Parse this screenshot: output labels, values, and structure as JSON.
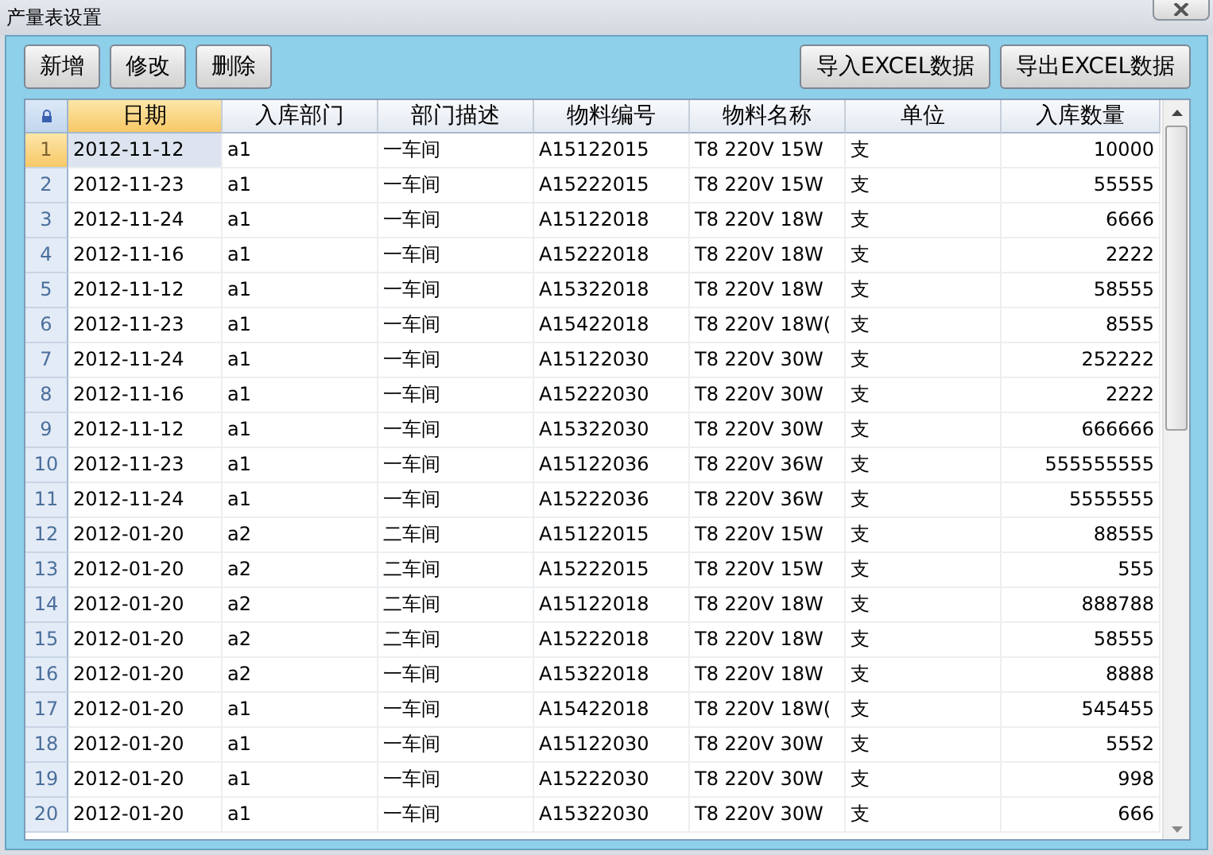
{
  "window": {
    "title": "产量表设置"
  },
  "toolbar": {
    "left_buttons": [
      "新增",
      "修改",
      "删除"
    ],
    "right_buttons": [
      "导入EXCEL数据",
      "导出EXCEL数据"
    ]
  },
  "table": {
    "columns": [
      {
        "label": "日期",
        "selected": true
      },
      {
        "label": "入库部门",
        "selected": false
      },
      {
        "label": "部门描述",
        "selected": false
      },
      {
        "label": "物料编号",
        "selected": false
      },
      {
        "label": "物料名称",
        "selected": false
      },
      {
        "label": "单位",
        "selected": false
      },
      {
        "label": "入库数量",
        "selected": false
      }
    ],
    "rows": [
      {
        "num": "1",
        "selected": true,
        "cells": [
          "2012-11-12",
          "a1",
          "一车间",
          "A15122015",
          "T8 220V 15W",
          "支",
          "10000"
        ]
      },
      {
        "num": "2",
        "selected": false,
        "cells": [
          "2012-11-23",
          "a1",
          "一车间",
          "A15222015",
          "T8 220V 15W",
          "支",
          "55555"
        ]
      },
      {
        "num": "3",
        "selected": false,
        "cells": [
          "2012-11-24",
          "a1",
          "一车间",
          "A15122018",
          "T8 220V 18W",
          "支",
          "6666"
        ]
      },
      {
        "num": "4",
        "selected": false,
        "cells": [
          "2012-11-16",
          "a1",
          "一车间",
          "A15222018",
          "T8 220V 18W",
          "支",
          "2222"
        ]
      },
      {
        "num": "5",
        "selected": false,
        "cells": [
          "2012-11-12",
          "a1",
          "一车间",
          "A15322018",
          "T8 220V 18W",
          "支",
          "58555"
        ]
      },
      {
        "num": "6",
        "selected": false,
        "cells": [
          "2012-11-23",
          "a1",
          "一车间",
          "A15422018",
          "T8 220V 18W(",
          "支",
          "8555"
        ]
      },
      {
        "num": "7",
        "selected": false,
        "cells": [
          "2012-11-24",
          "a1",
          "一车间",
          "A15122030",
          "T8 220V 30W",
          "支",
          "252222"
        ]
      },
      {
        "num": "8",
        "selected": false,
        "cells": [
          "2012-11-16",
          "a1",
          "一车间",
          "A15222030",
          "T8 220V 30W",
          "支",
          "2222"
        ]
      },
      {
        "num": "9",
        "selected": false,
        "cells": [
          "2012-11-12",
          "a1",
          "一车间",
          "A15322030",
          "T8 220V 30W",
          "支",
          "666666"
        ]
      },
      {
        "num": "10",
        "selected": false,
        "cells": [
          "2012-11-23",
          "a1",
          "一车间",
          "A15122036",
          "T8 220V 36W",
          "支",
          "555555555"
        ]
      },
      {
        "num": "11",
        "selected": false,
        "cells": [
          "2012-11-24",
          "a1",
          "一车间",
          "A15222036",
          "T8 220V 36W",
          "支",
          "5555555"
        ]
      },
      {
        "num": "12",
        "selected": false,
        "cells": [
          "2012-01-20",
          "a2",
          "二车间",
          "A15122015",
          "T8 220V 15W",
          "支",
          "88555"
        ]
      },
      {
        "num": "13",
        "selected": false,
        "cells": [
          "2012-01-20",
          "a2",
          "二车间",
          "A15222015",
          "T8 220V 15W",
          "支",
          "555"
        ]
      },
      {
        "num": "14",
        "selected": false,
        "cells": [
          "2012-01-20",
          "a2",
          "二车间",
          "A15122018",
          "T8 220V 18W",
          "支",
          "888788"
        ]
      },
      {
        "num": "15",
        "selected": false,
        "cells": [
          "2012-01-20",
          "a2",
          "二车间",
          "A15222018",
          "T8 220V 18W",
          "支",
          "58555"
        ]
      },
      {
        "num": "16",
        "selected": false,
        "cells": [
          "2012-01-20",
          "a2",
          "一车间",
          "A15322018",
          "T8 220V 18W",
          "支",
          "8888"
        ]
      },
      {
        "num": "17",
        "selected": false,
        "cells": [
          "2012-01-20",
          "a1",
          "一车间",
          "A15422018",
          "T8 220V 18W(",
          "支",
          "545455"
        ]
      },
      {
        "num": "18",
        "selected": false,
        "cells": [
          "2012-01-20",
          "a1",
          "一车间",
          "A15122030",
          "T8 220V 30W",
          "支",
          "5552"
        ]
      },
      {
        "num": "19",
        "selected": false,
        "cells": [
          "2012-01-20",
          "a1",
          "一车间",
          "A15222030",
          "T8 220V 30W",
          "支",
          "998"
        ]
      },
      {
        "num": "20",
        "selected": false,
        "cells": [
          "2012-01-20",
          "a1",
          "一车间",
          "A15322030",
          "T8 220V 30W",
          "支",
          "666"
        ]
      }
    ]
  }
}
